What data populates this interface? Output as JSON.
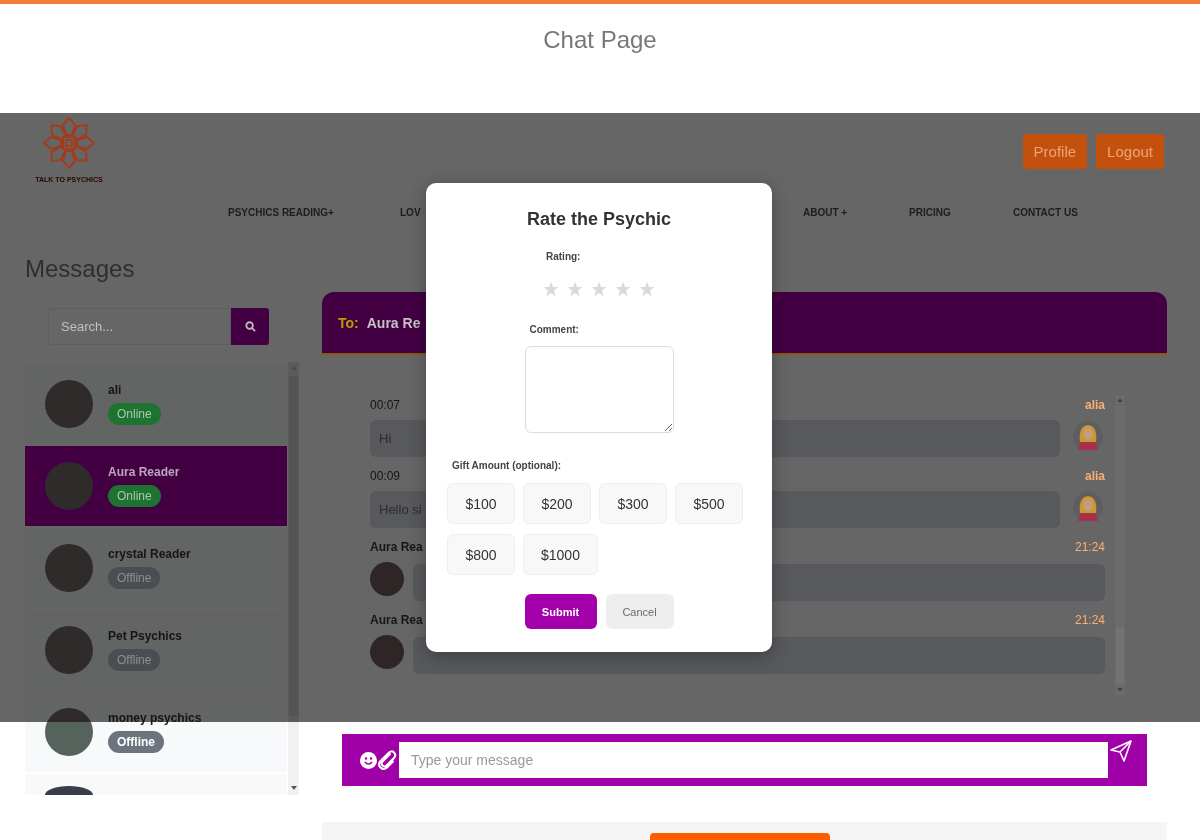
{
  "page_title": "Chat Page",
  "site": {
    "logo_text": "TALK TO PSYCHICS",
    "header_buttons": [
      {
        "label": "Profile"
      },
      {
        "label": "Logout"
      }
    ],
    "nav": [
      {
        "label": "PSYCHICS READING+"
      },
      {
        "label": "LOV"
      },
      {
        "label": "ABOUT +"
      },
      {
        "label": "PRICING"
      },
      {
        "label": "CONTACT US"
      }
    ]
  },
  "sidebar": {
    "title": "Messages",
    "search": {
      "placeholder": "Search..."
    },
    "contacts": [
      {
        "name": "ali",
        "status": "Online",
        "online": true,
        "selected": false
      },
      {
        "name": "Aura Reader",
        "status": "Online",
        "online": true,
        "selected": true
      },
      {
        "name": "crystal Reader",
        "status": "Offline",
        "online": false,
        "selected": false
      },
      {
        "name": "Pet Psychics",
        "status": "Offline",
        "online": false,
        "selected": false
      },
      {
        "name": "money psychics",
        "status": "Offline",
        "online": false,
        "selected": false
      }
    ]
  },
  "chat": {
    "to_label": "To:",
    "recipient": "Aura Re",
    "messages": [
      {
        "kind": "sent",
        "time": "00:07",
        "sender": "alia",
        "text": "Hi"
      },
      {
        "kind": "sent",
        "time": "00:09",
        "sender": "alia",
        "text": "Hello si"
      },
      {
        "kind": "received",
        "sender": "Aura Rea",
        "time": "21:24"
      },
      {
        "kind": "received",
        "sender": "Aura Rea",
        "time": "21:24"
      }
    ],
    "composer": {
      "placeholder": "Type your message"
    }
  },
  "modal": {
    "title": "Rate the Psychic",
    "rating_label": "Rating:",
    "stars": 0,
    "comment_label": "Comment:",
    "gift_label": "Gift Amount (optional):",
    "gift_amounts": [
      {
        "label": "$100",
        "selected": false
      },
      {
        "label": "$200",
        "selected": false
      },
      {
        "label": "$300",
        "selected": false
      },
      {
        "label": "$500",
        "selected": false
      },
      {
        "label": "$800",
        "selected": false
      },
      {
        "label": "$1000",
        "selected": false
      }
    ],
    "buttons": [
      {
        "kind": "submit",
        "label": "Submit"
      },
      {
        "kind": "cancel",
        "label": "Cancel"
      }
    ]
  }
}
